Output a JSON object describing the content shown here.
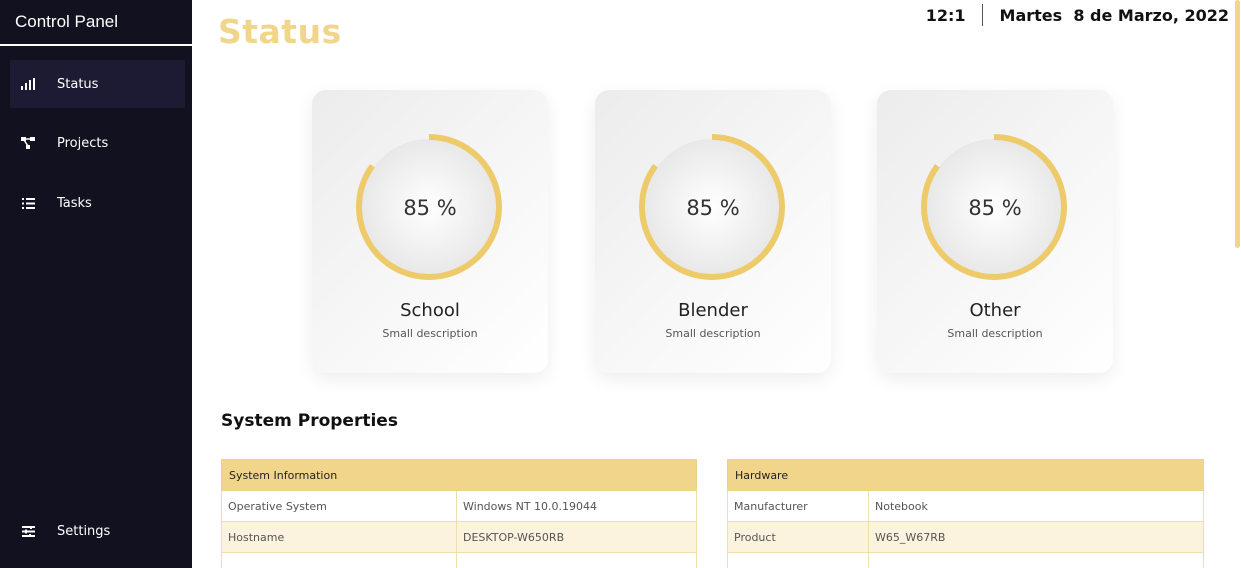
{
  "sidebar": {
    "brand": "Control Panel",
    "items": [
      {
        "label": "Status",
        "icon": "signal-bars-icon",
        "active": true
      },
      {
        "label": "Projects",
        "icon": "nodes-icon",
        "active": false
      },
      {
        "label": "Tasks",
        "icon": "checklist-icon",
        "active": false
      }
    ],
    "settings": {
      "label": "Settings",
      "icon": "sliders-icon"
    }
  },
  "header": {
    "title": "Status",
    "time": "12:1",
    "date": "Martes  8 de Marzo, 2022"
  },
  "cards": [
    {
      "percent_text": "85 %",
      "percent": 85,
      "name": "School",
      "description": "Small description"
    },
    {
      "percent_text": "85 %",
      "percent": 85,
      "name": "Blender",
      "description": "Small description"
    },
    {
      "percent_text": "85 %",
      "percent": 85,
      "name": "Other",
      "description": "Small description"
    }
  ],
  "system": {
    "title": "System Properties",
    "info": {
      "header": "System Information",
      "rows": [
        [
          "Operative System",
          "Windows NT 10.0.19044"
        ],
        [
          "Hostname",
          "DESKTOP-W650RB"
        ],
        [
          "",
          ""
        ]
      ]
    },
    "hardware": {
      "header": "Hardware",
      "rows": [
        [
          "Manufacturer",
          "Notebook"
        ],
        [
          "Product",
          "W65_W67RB"
        ],
        [
          "",
          ""
        ]
      ]
    }
  },
  "colors": {
    "accent": "#f0d58a",
    "ring": "#eecb6a",
    "sidebar_bg": "#12111f",
    "sidebar_active": "#1c1b33"
  }
}
